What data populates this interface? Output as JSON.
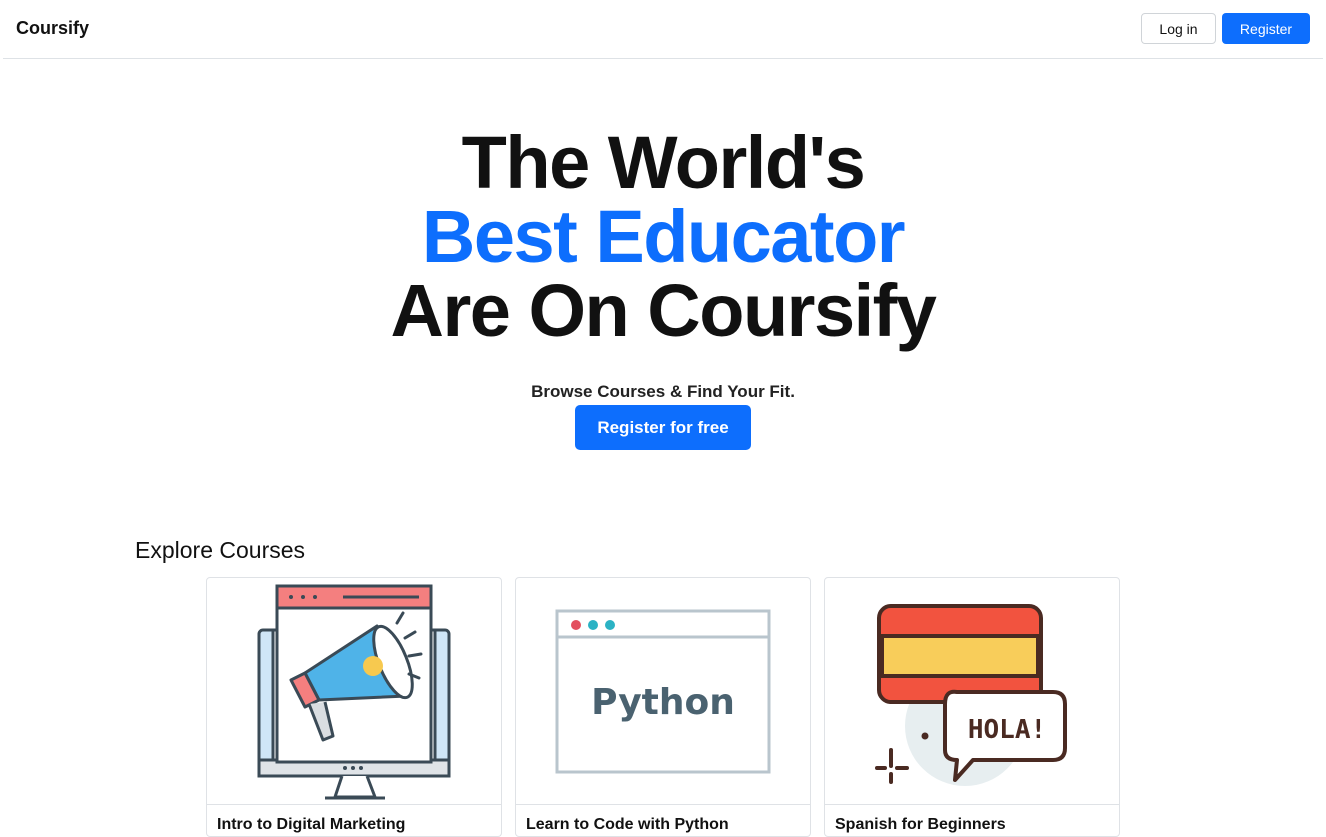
{
  "navbar": {
    "brand": "Coursify",
    "login_label": "Log in",
    "register_label": "Register"
  },
  "hero": {
    "line1": "The World's",
    "line2": "Best Educator",
    "line3": "Are On Coursify",
    "subtitle": "Browse Courses & Find Your Fit.",
    "cta_label": "Register for free"
  },
  "explore": {
    "title": "Explore Courses",
    "courses": [
      {
        "title": "Intro to Digital Marketing",
        "icon": "megaphone-monitor-icon"
      },
      {
        "title": "Learn to Code with Python",
        "icon": "python-window-icon",
        "image_text": "Python"
      },
      {
        "title": "Spanish for Beginners",
        "icon": "spanish-flag-hola-icon",
        "image_text": "HOLA!"
      }
    ]
  },
  "colors": {
    "accent": "#0d6efd",
    "text": "#111111"
  }
}
